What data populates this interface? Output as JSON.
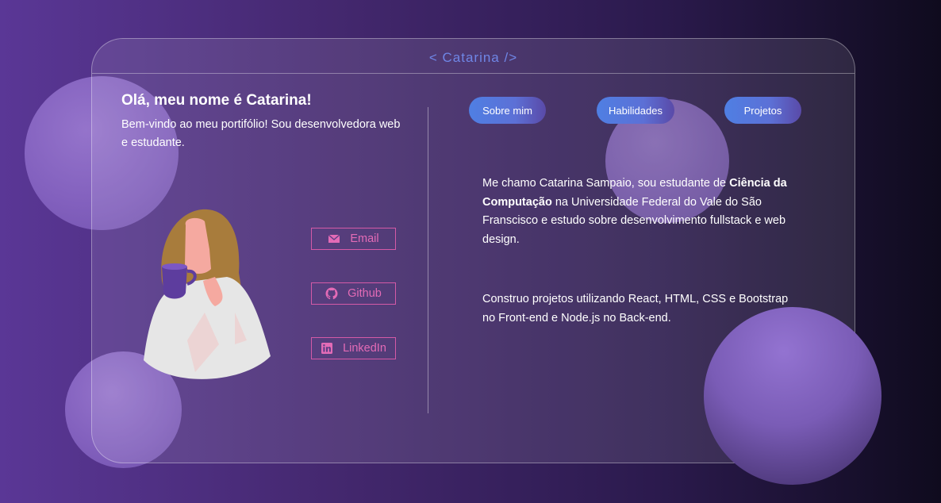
{
  "header": {
    "title": "< Catarina />"
  },
  "intro": {
    "heading": "Olá, meu nome é Catarina!",
    "text": "Bem-vindo ao meu portifólio! Sou desenvolvedora web e estudante."
  },
  "social": {
    "email_label": "Email",
    "github_label": "Github",
    "linkedin_label": "LinkedIn"
  },
  "tabs": [
    {
      "label": "Sobre mim"
    },
    {
      "label": "Habilidades"
    },
    {
      "label": "Projetos"
    }
  ],
  "about": {
    "p1_before": "Me chamo Catarina Sampaio, sou estudante de ",
    "p1_bold": "Ciência da Computação",
    "p1_after": " na Universidade Federal do Vale do São Franscisco e estudo sobre desenvolvimento fullstack e web design.",
    "p2": "Construo projetos utilizando React, HTML, CSS e Bootstrap no Front-end e Node.js no Back-end."
  },
  "colors": {
    "accent_title": "#6f86e6",
    "social_pink": "#e36bb6",
    "tab_blue": "#4f7fe3"
  },
  "icons": {
    "email": "envelope-icon",
    "github": "github-icon",
    "linkedin": "linkedin-icon"
  }
}
